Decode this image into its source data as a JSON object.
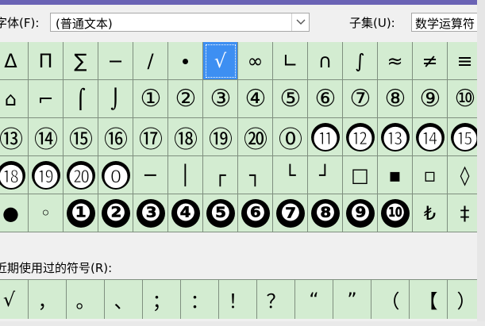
{
  "font": {
    "label": "字体(F):",
    "selected": "(普通文本)"
  },
  "subset": {
    "label": "子集(U):",
    "selected": "数学运算符"
  },
  "grid_rows": [
    [
      {
        "c": "Δ"
      },
      {
        "c": "Π"
      },
      {
        "c": "∑"
      },
      {
        "c": "−"
      },
      {
        "c": "∕"
      },
      {
        "c": "∙"
      },
      {
        "c": "√",
        "sel": true
      },
      {
        "c": "∞"
      },
      {
        "c": "∟"
      },
      {
        "c": "∩"
      },
      {
        "c": "∫"
      },
      {
        "c": "≈"
      },
      {
        "c": "≠"
      },
      {
        "c": "≡"
      }
    ],
    [
      {
        "c": "⌂"
      },
      {
        "c": "⌐"
      },
      {
        "c": "⌠"
      },
      {
        "c": "⌡"
      },
      {
        "c": "①",
        "k": "circ"
      },
      {
        "c": "②",
        "k": "circ"
      },
      {
        "c": "③",
        "k": "circ"
      },
      {
        "c": "④",
        "k": "circ"
      },
      {
        "c": "⑤",
        "k": "circ"
      },
      {
        "c": "⑥",
        "k": "circ"
      },
      {
        "c": "⑦",
        "k": "circ"
      },
      {
        "c": "⑧",
        "k": "circ"
      },
      {
        "c": "⑨",
        "k": "circ"
      },
      {
        "c": "⑩",
        "k": "circ"
      }
    ],
    [
      {
        "c": "⑬",
        "k": "circ"
      },
      {
        "c": "⑭",
        "k": "circ"
      },
      {
        "c": "⑮",
        "k": "circ"
      },
      {
        "c": "⑯",
        "k": "circ"
      },
      {
        "c": "⑰",
        "k": "circ"
      },
      {
        "c": "⑱",
        "k": "circ"
      },
      {
        "c": "⑲",
        "k": "circ"
      },
      {
        "c": "⑳",
        "k": "circ"
      },
      {
        "c": "⓪",
        "k": "circ"
      },
      {
        "c": "⓫",
        "k": "inv"
      },
      {
        "c": "⓬",
        "k": "inv"
      },
      {
        "c": "⓭",
        "k": "inv"
      },
      {
        "c": "⓮",
        "k": "inv"
      },
      {
        "c": "⓯",
        "k": "inv"
      }
    ],
    [
      {
        "c": "⓲",
        "k": "inv"
      },
      {
        "c": "⓳",
        "k": "inv"
      },
      {
        "c": "⓴",
        "k": "inv"
      },
      {
        "c": "⓿",
        "k": "inv"
      },
      {
        "c": "─"
      },
      {
        "c": "│"
      },
      {
        "c": "┌"
      },
      {
        "c": "┐"
      },
      {
        "c": "└"
      },
      {
        "c": "┘"
      },
      {
        "c": "□"
      },
      {
        "c": "▪"
      },
      {
        "c": "▫"
      },
      {
        "c": "◊"
      }
    ],
    [
      {
        "c": "●"
      },
      {
        "c": "◦"
      },
      {
        "c": "❶",
        "k": "inv"
      },
      {
        "c": "❷",
        "k": "inv"
      },
      {
        "c": "❸",
        "k": "inv"
      },
      {
        "c": "❹",
        "k": "inv"
      },
      {
        "c": "❺",
        "k": "inv"
      },
      {
        "c": "❻",
        "k": "inv"
      },
      {
        "c": "❼",
        "k": "inv"
      },
      {
        "c": "❽",
        "k": "inv"
      },
      {
        "c": "❾",
        "k": "inv"
      },
      {
        "c": "❿",
        "k": "inv"
      },
      {
        "c": "₺"
      },
      {
        "c": "‡"
      }
    ]
  ],
  "recent_label": "近期使用过的符号(R):",
  "recent": [
    "√",
    "，",
    "。",
    "、",
    "；",
    "：",
    "！",
    "？",
    "“",
    "”",
    "（",
    "【",
    "）",
    "％"
  ]
}
